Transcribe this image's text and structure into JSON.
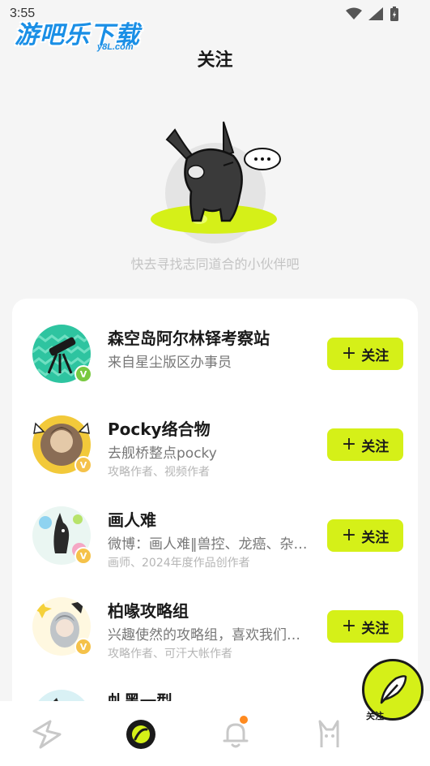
{
  "status_bar": {
    "time": "3:55"
  },
  "watermark": {
    "text": "游吧乐下载",
    "sub": "y8L.com"
  },
  "header": {
    "title": "关注"
  },
  "empty_state": {
    "hint": "快去寻找志同道合的小伙伴吧"
  },
  "suggestions": [
    {
      "name": "森空岛阿尔林铎考察站",
      "desc": "来自星尘版区办事员",
      "tags": "",
      "follow_label": "关注",
      "badge": "green"
    },
    {
      "name": "Pocky络合物",
      "desc": "去舰桥整点pocky",
      "tags": "攻略作者、视频作者",
      "follow_label": "关注",
      "badge": "gold"
    },
    {
      "name": "画人难",
      "desc": "微博：画人难‖兽控、龙癌、杂…",
      "tags": "画师、2024年度作品创作者",
      "follow_label": "关注",
      "badge": "gold"
    },
    {
      "name": "柏喙攻略组",
      "desc": "兴趣使然的攻略组，喜欢我们…",
      "tags": "攻略作者、可汗大帐作者",
      "follow_label": "关注",
      "badge": "gold"
    },
    {
      "name": "虬黑一型",
      "desc": "",
      "tags": "",
      "follow_label": "",
      "badge": ""
    }
  ],
  "fab": {
    "label": "关注"
  },
  "bottom_nav": [
    {
      "icon": "home-icon",
      "active": false
    },
    {
      "icon": "discover-icon",
      "active": true
    },
    {
      "icon": "bell-icon",
      "active": false,
      "has_dot": true
    },
    {
      "icon": "profile-icon",
      "active": false
    }
  ],
  "colors": {
    "accent": "#d5f018",
    "badge_gold": "#f5c24a",
    "badge_green": "#79c940",
    "notification_dot": "#ff8a1f"
  }
}
